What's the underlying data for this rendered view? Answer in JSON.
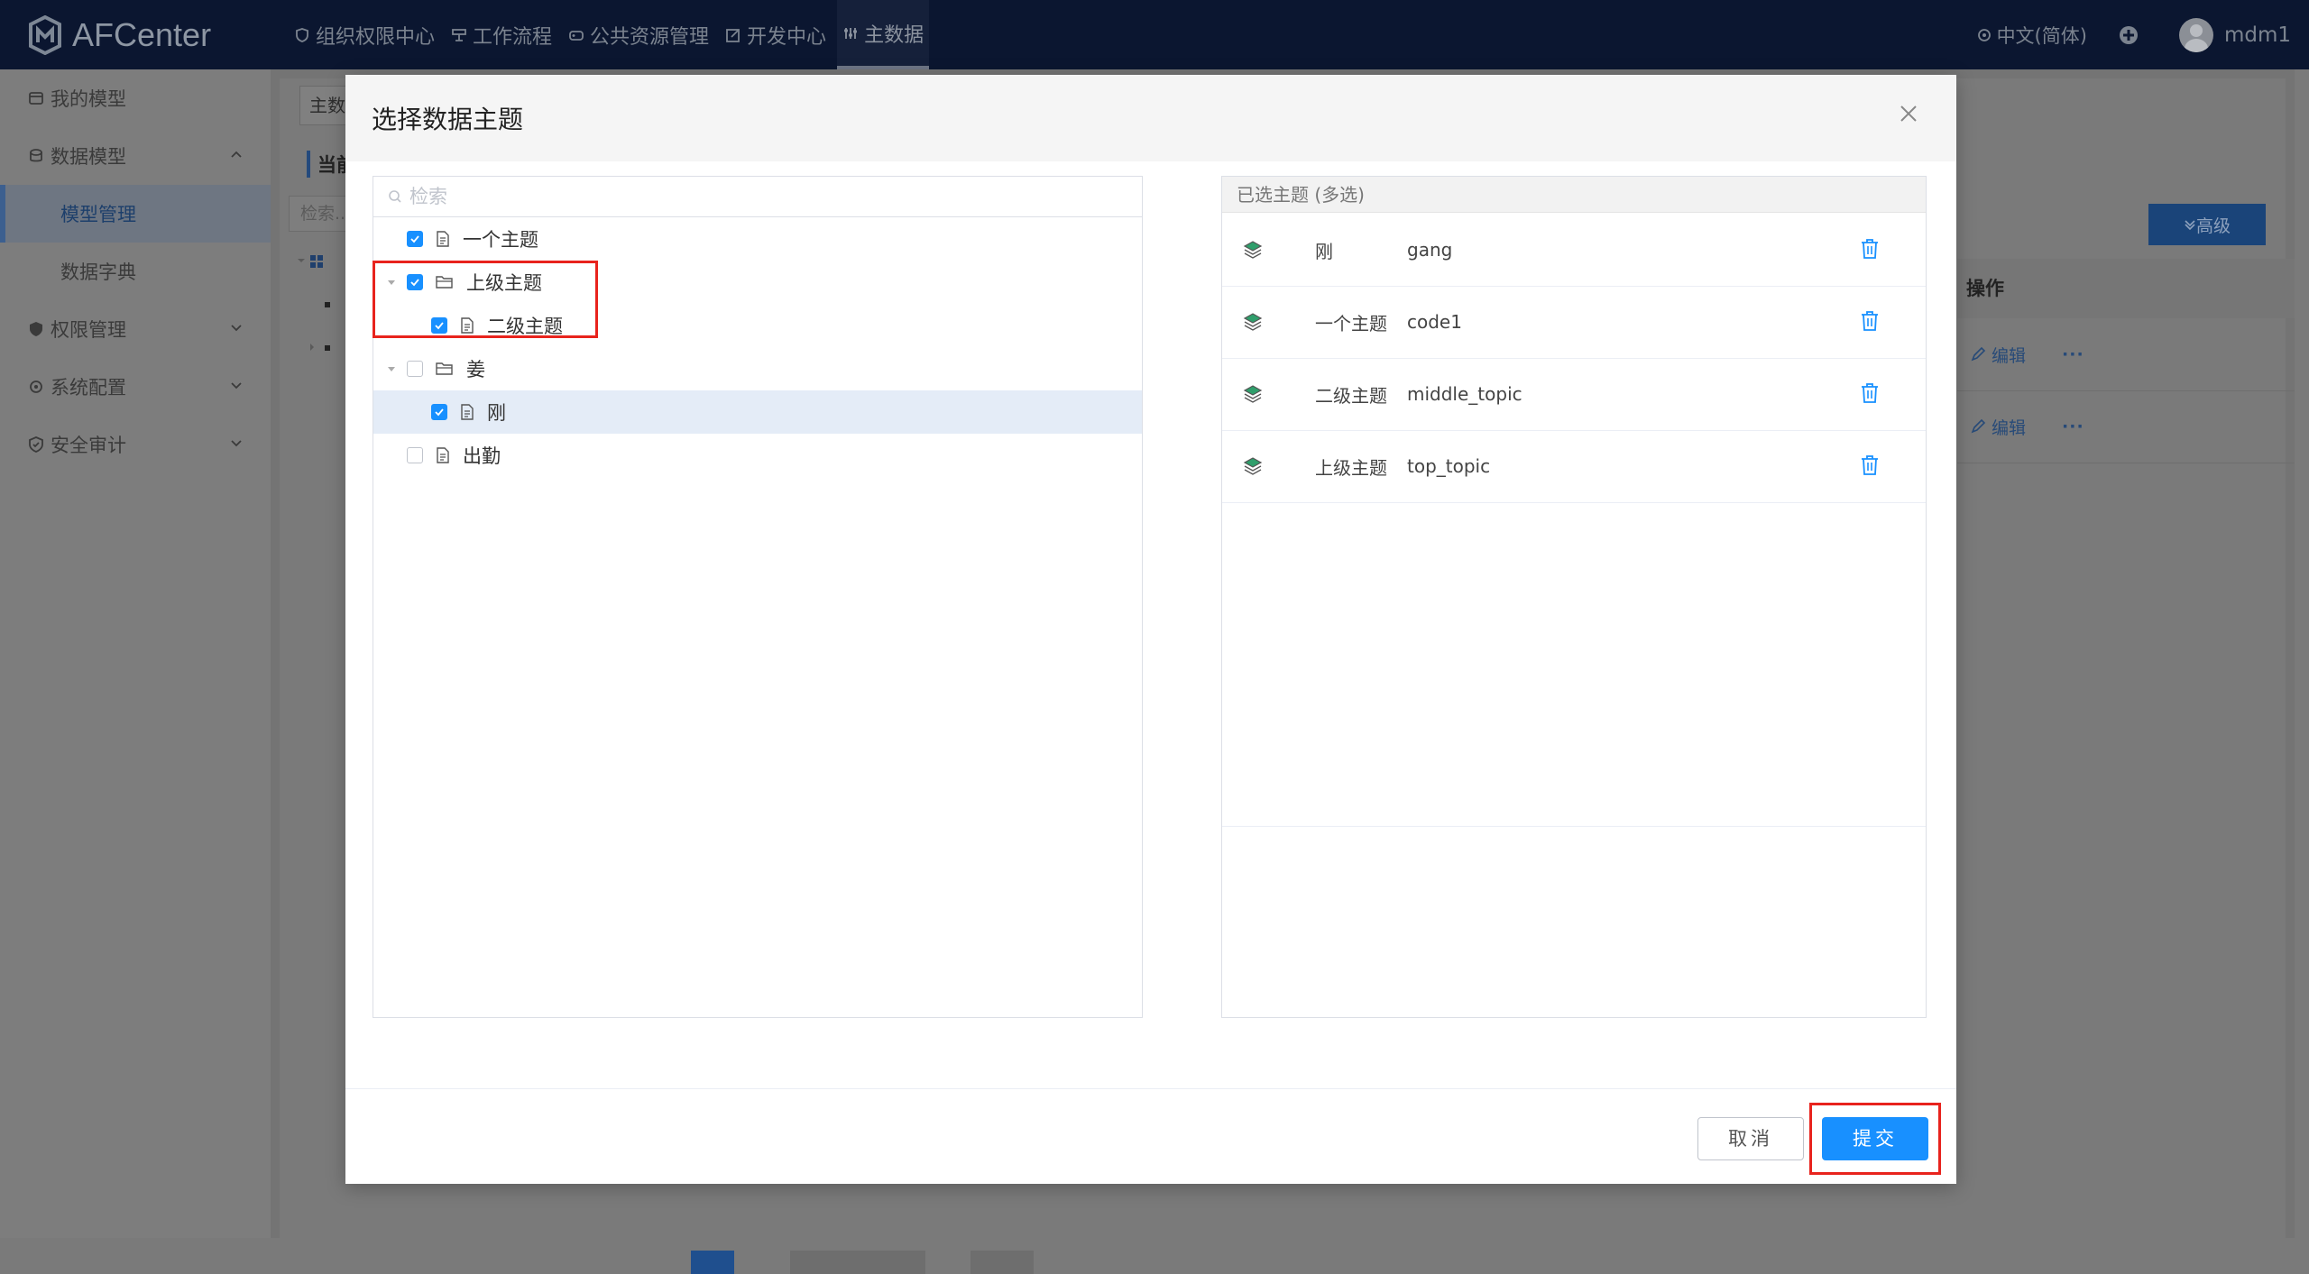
{
  "app": {
    "logo_text": "AFCenter"
  },
  "topnav": {
    "items": [
      {
        "label": "组织权限中心",
        "icon": "shield-heart-icon"
      },
      {
        "label": "工作流程",
        "icon": "flow-icon"
      },
      {
        "label": "公共资源管理",
        "icon": "gamepad-icon"
      },
      {
        "label": "开发中心",
        "icon": "edit-icon"
      },
      {
        "label": "主数据",
        "icon": "data-icon",
        "active": true
      }
    ],
    "language": "中文(简体)",
    "username": "mdm1"
  },
  "sidebar": {
    "items": [
      {
        "label": "我的模型",
        "icon": "model-icon"
      },
      {
        "label": "数据模型",
        "icon": "database-icon",
        "expanded": true
      },
      {
        "label": "模型管理",
        "sub": true,
        "active": true
      },
      {
        "label": "数据字典",
        "sub": true
      },
      {
        "label": "权限管理",
        "icon": "shield-icon"
      },
      {
        "label": "系统配置",
        "icon": "settings-icon"
      },
      {
        "label": "安全审计",
        "icon": "audit-icon"
      }
    ]
  },
  "background": {
    "tab": "主数",
    "title": "当前",
    "search_placeholder": "检索...",
    "advanced": "高级",
    "column_action": "操作",
    "row_action": "编辑",
    "row_more": "···"
  },
  "modal": {
    "title": "选择数据主题",
    "search_placeholder": "检索",
    "tree": [
      {
        "label": "一个主题",
        "level": 0,
        "type": "file",
        "checked": true
      },
      {
        "label": "上级主题",
        "level": 0,
        "type": "folder",
        "checked": true,
        "expanded": true
      },
      {
        "label": "二级主题",
        "level": 1,
        "type": "file",
        "checked": true
      },
      {
        "label": "姜",
        "level": 0,
        "type": "folder",
        "checked": false,
        "expanded": true
      },
      {
        "label": "刚",
        "level": 1,
        "type": "file",
        "checked": true,
        "selected": true
      },
      {
        "label": "出勤",
        "level": 0,
        "type": "file",
        "checked": false
      }
    ],
    "selected_header": "已选主题 (多选)",
    "selected": [
      {
        "name": "刚",
        "code": "gang"
      },
      {
        "name": "一个主题",
        "code": "code1"
      },
      {
        "name": "二级主题",
        "code": "middle_topic"
      },
      {
        "name": "上级主题",
        "code": "top_topic"
      }
    ],
    "cancel_label": "取消",
    "submit_label": "提交"
  },
  "colors": {
    "primary": "#1890ff",
    "topbar": "#0b1630",
    "highlight": "#e8231d"
  }
}
